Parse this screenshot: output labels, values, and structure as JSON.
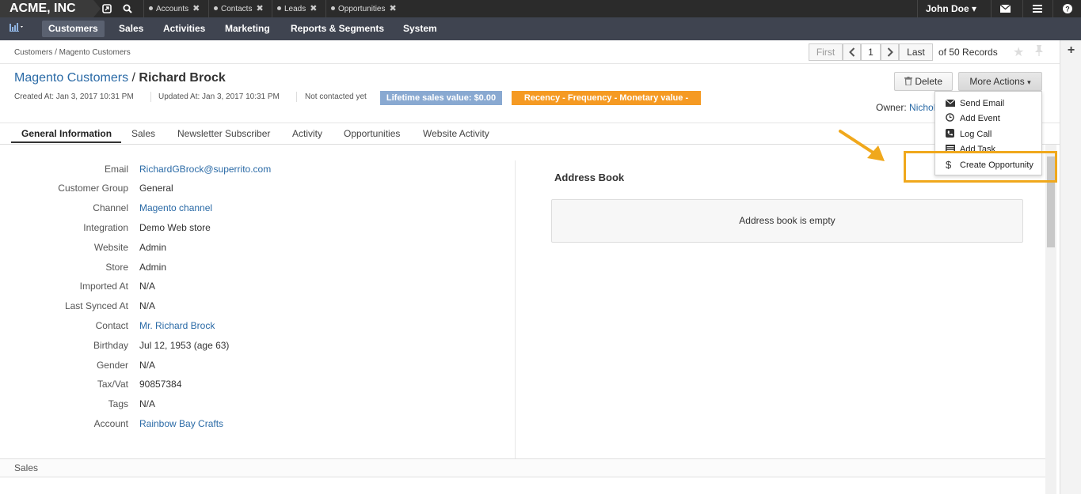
{
  "topbar": {
    "brand": "ACME, INC",
    "tabs": [
      "Accounts",
      "Contacts",
      "Leads",
      "Opportunities"
    ],
    "user": "John Doe"
  },
  "menu": [
    "Customers",
    "Sales",
    "Activities",
    "Marketing",
    "Reports & Segments",
    "System"
  ],
  "breadcrumb": "Customers / Magento Customers",
  "pager": {
    "first": "First",
    "page": "1",
    "last": "Last",
    "total": "of 50 Records"
  },
  "header": {
    "parent": "Magento Customers",
    "separator": " / ",
    "name": "Richard Brock",
    "created": "Created At: Jan 3, 2017 10:31 PM",
    "updated": "Updated At: Jan 3, 2017 10:31 PM",
    "contacted": "Not contacted yet",
    "lifetime_badge": "Lifetime sales value: $0.00",
    "rfm_badge": "Recency -   Frequency -   Monetary value -",
    "owner_label": "Owner:",
    "owner_name": "Nichol"
  },
  "buttons": {
    "delete": "Delete",
    "more_actions": "More Actions"
  },
  "more_actions_menu": [
    "Send Email",
    "Add Event",
    "Log Call",
    "Add Task",
    "Create Opportunity"
  ],
  "tabs": [
    "General Information",
    "Sales",
    "Newsletter Subscriber",
    "Activity",
    "Opportunities",
    "Website Activity"
  ],
  "fields": [
    {
      "label": "Email",
      "value": "RichardGBrock@superrito.com",
      "link": true
    },
    {
      "label": "Customer Group",
      "value": "General",
      "link": false
    },
    {
      "label": "Channel",
      "value": "Magento channel",
      "link": true
    },
    {
      "label": "Integration",
      "value": "Demo Web store",
      "link": false
    },
    {
      "label": "Website",
      "value": "Admin",
      "link": false
    },
    {
      "label": "Store",
      "value": "Admin",
      "link": false
    },
    {
      "label": "Imported At",
      "value": "N/A",
      "link": false
    },
    {
      "label": "Last Synced At",
      "value": "N/A",
      "link": false
    },
    {
      "label": "Contact",
      "value": "Mr. Richard Brock",
      "link": true
    },
    {
      "label": "Birthday",
      "value": "Jul 12, 1953 (age 63)",
      "link": false
    },
    {
      "label": "Gender",
      "value": "N/A",
      "link": false
    },
    {
      "label": "Tax/Vat",
      "value": "90857384",
      "link": false
    },
    {
      "label": "Tags",
      "value": "N/A",
      "link": false
    },
    {
      "label": "Account",
      "value": "Rainbow Bay Crafts",
      "link": true
    }
  ],
  "address_book": {
    "title": "Address Book",
    "empty": "Address book is empty"
  },
  "sales_section": "Sales",
  "colors": {
    "accent_link": "#2a6aa6",
    "highlight": "#f0a81c",
    "badge_blue": "#89a9d1",
    "badge_orange": "#f59a23"
  }
}
